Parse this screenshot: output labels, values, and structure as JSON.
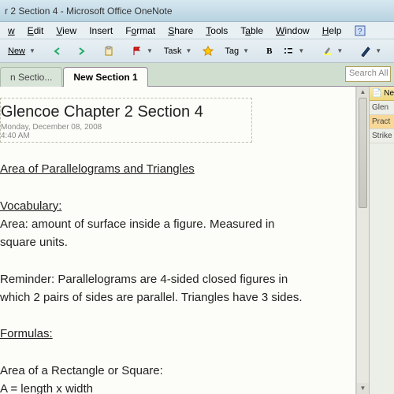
{
  "window": {
    "title": "r 2 Section 4 - Microsoft Office OneNote"
  },
  "menu": {
    "file_u": "w",
    "edit": "Edit",
    "view": "View",
    "insert": "Insert",
    "format": "Format",
    "share": "Share",
    "tools": "Tools",
    "table": "Table",
    "window": "Window",
    "help": "Help"
  },
  "toolbar": {
    "new_label": "New",
    "task_label": "Task",
    "tag_label": "Tag"
  },
  "tabs": {
    "t0": "n Sectio...",
    "t1": "New Section 1"
  },
  "search": {
    "placeholder": "Search All"
  },
  "page": {
    "title": "Glencoe Chapter 2 Section 4",
    "date": "Monday, December 08, 2008",
    "time": "4:40 AM"
  },
  "note": {
    "h1": "Area of Parallelograms and Triangles",
    "vocab_h": "Vocabulary:",
    "vocab_1a": "Area: amount of surface inside a figure. Measured in",
    "vocab_1b": "square units.",
    "rem_1": "Reminder: Parallelograms are 4-sided closed figures in",
    "rem_2": "which 2 pairs of sides are parallel. Triangles have 3 sides.",
    "form_h": "Formulas:",
    "form_1": "Area of a Rectangle or Square:",
    "form_2": "A = length x width"
  },
  "side": {
    "head": "Ne",
    "i0": "Glen",
    "i1": "Pract",
    "i2": "Strike"
  }
}
